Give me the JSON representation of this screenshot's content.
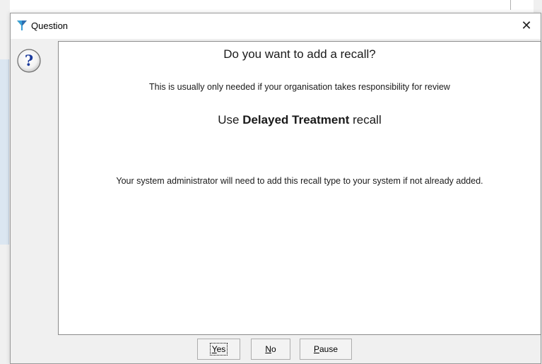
{
  "window": {
    "title": "Question",
    "close_glyph": "✕"
  },
  "icons": {
    "app": "filter-funnel-icon",
    "message": "question-icon"
  },
  "message": {
    "heading": "Do you want to add a recall?",
    "subtext": "This is usually only needed if your organisation takes responsibility for review",
    "recall_prefix": "Use ",
    "recall_bold": "Delayed Treatment",
    "recall_suffix": " recall",
    "admin_note": "Your system administrator will need to add this recall type to your system if not already added."
  },
  "buttons": {
    "yes": {
      "mnemonic": "Y",
      "rest": "es"
    },
    "no": {
      "mnemonic": "N",
      "rest": "o"
    },
    "pause": {
      "mnemonic": "P",
      "rest": "ause"
    }
  },
  "colors": {
    "dialog_bg": "#f0f0f0",
    "panel_bg": "#ffffff",
    "border": "#8a8a8a",
    "question_blue": "#1c3b9c"
  }
}
